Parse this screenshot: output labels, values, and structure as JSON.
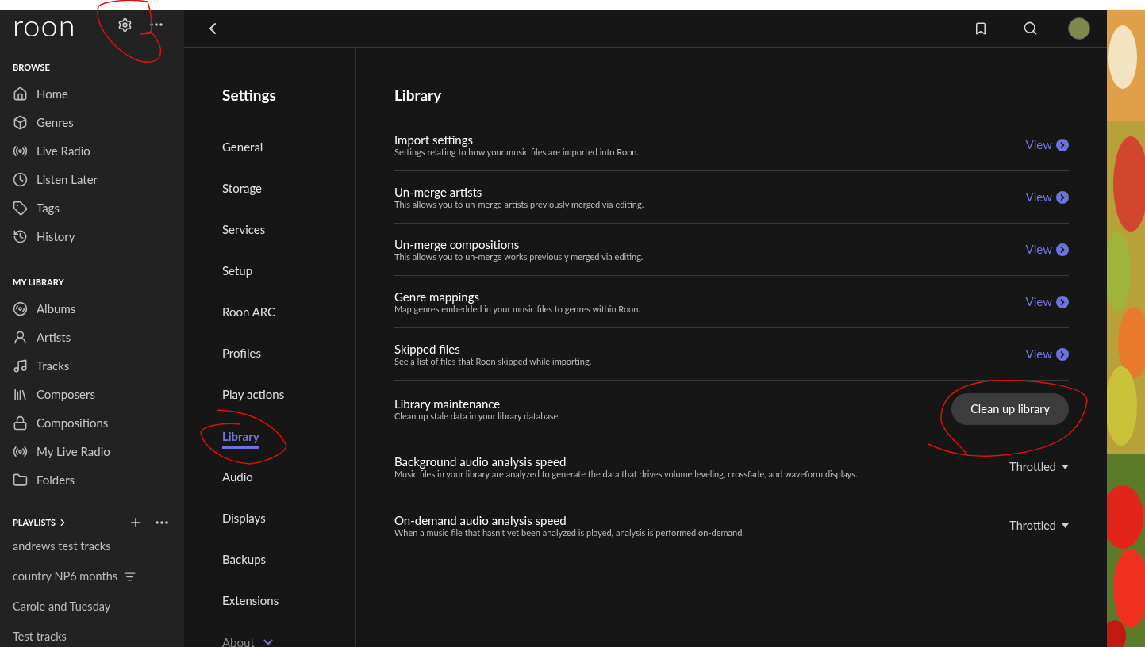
{
  "app": {
    "logo": "roon"
  },
  "sidebar": {
    "sections": [
      {
        "title": "BROWSE",
        "items": [
          {
            "label": "Home"
          },
          {
            "label": "Genres"
          },
          {
            "label": "Live Radio"
          },
          {
            "label": "Listen Later"
          },
          {
            "label": "Tags"
          },
          {
            "label": "History"
          }
        ]
      },
      {
        "title": "MY LIBRARY",
        "items": [
          {
            "label": "Albums"
          },
          {
            "label": "Artists"
          },
          {
            "label": "Tracks"
          },
          {
            "label": "Composers"
          },
          {
            "label": "Compositions"
          },
          {
            "label": "My Live Radio"
          },
          {
            "label": "Folders"
          }
        ]
      }
    ],
    "playlists": {
      "title": "PLAYLISTS",
      "items": [
        {
          "label": "andrews test tracks",
          "kind": "plain"
        },
        {
          "label": "country NP6 months",
          "kind": "smart"
        },
        {
          "label": "Carole and Tuesday",
          "kind": "plain"
        },
        {
          "label": "Test tracks",
          "kind": "plain"
        }
      ]
    }
  },
  "settings_nav": {
    "title": "Settings",
    "items": [
      {
        "label": "General",
        "selected": false
      },
      {
        "label": "Storage",
        "selected": false
      },
      {
        "label": "Services",
        "selected": false
      },
      {
        "label": "Setup",
        "selected": false
      },
      {
        "label": "Roon ARC",
        "selected": false
      },
      {
        "label": "Profiles",
        "selected": false
      },
      {
        "label": "Play actions",
        "selected": false
      },
      {
        "label": "Library",
        "selected": true
      },
      {
        "label": "Audio",
        "selected": false
      },
      {
        "label": "Displays",
        "selected": false
      },
      {
        "label": "Backups",
        "selected": false
      },
      {
        "label": "Extensions",
        "selected": false
      }
    ],
    "more": {
      "label": "About"
    }
  },
  "content": {
    "title": "Library",
    "rows": [
      {
        "kind": "link",
        "title": "Import settings",
        "description": "Settings relating to how your music files are imported into Roon.",
        "action": "View"
      },
      {
        "kind": "link",
        "title": "Un-merge artists",
        "description": "This allows you to un-merge artists previously merged via editing.",
        "action": "View"
      },
      {
        "kind": "link",
        "title": "Un-merge compositions",
        "description": "This allows you to un-merge works previously merged via editing.",
        "action": "View"
      },
      {
        "kind": "link",
        "title": "Genre mappings",
        "description": "Map genres embedded in your music files to genres within Roon.",
        "action": "View"
      },
      {
        "kind": "link",
        "title": "Skipped files",
        "description": "See a list of files that Roon skipped while importing.",
        "action": "View"
      },
      {
        "kind": "button",
        "title": "Library maintenance",
        "description": "Clean up stale data in your library database.",
        "action": "Clean up library"
      },
      {
        "kind": "dropdown",
        "title": "Background audio analysis speed",
        "description": "Music files in your library are analyzed to generate the data that drives volume leveling, crossfade, and waveform displays.",
        "action": "Throttled"
      },
      {
        "kind": "dropdown",
        "title": "On-demand audio analysis speed",
        "description": "When a music file that hasn't yet been analyzed is played, analysis is performed on-demand.",
        "action": "Throttled"
      }
    ]
  }
}
